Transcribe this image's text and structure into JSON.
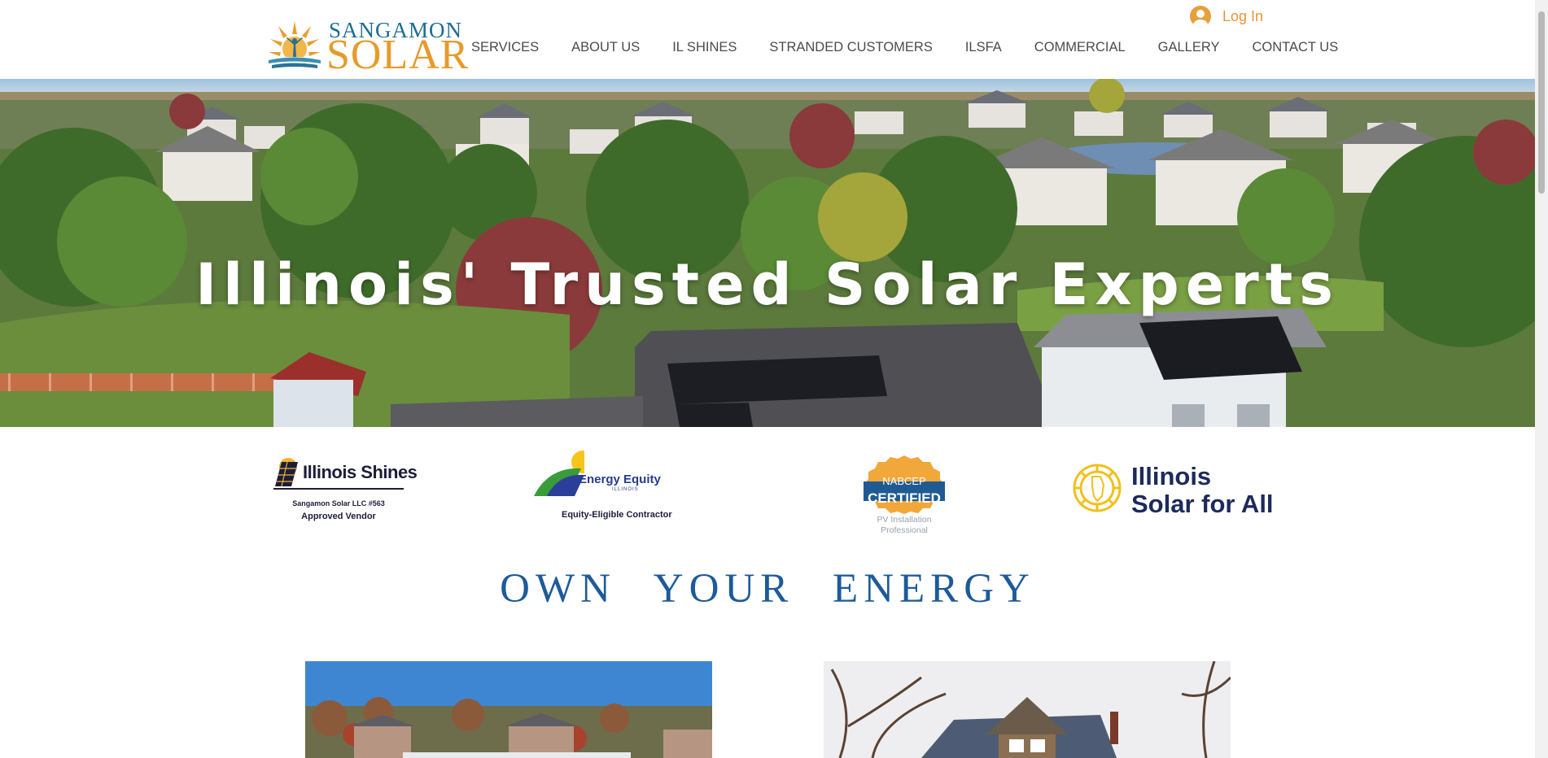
{
  "brand": {
    "name_top": "SANGAMON",
    "name_main": "SOLAR",
    "colors": {
      "orange": "#e59b2c",
      "teal": "#1c6d92",
      "heading_blue": "#1d5a99"
    }
  },
  "login": {
    "label": "Log In",
    "icon": "user-avatar-icon"
  },
  "nav": {
    "items": [
      {
        "label": "SERVICES"
      },
      {
        "label": "ABOUT US"
      },
      {
        "label": "IL SHINES"
      },
      {
        "label": "STRANDED CUSTOMERS"
      },
      {
        "label": "ILSFA"
      },
      {
        "label": "COMMERCIAL"
      },
      {
        "label": "GALLERY"
      },
      {
        "label": "CONTACT US"
      }
    ]
  },
  "hero": {
    "title": "Illinois' Trusted Solar Experts"
  },
  "badges": {
    "illinois_shines": {
      "title": "Illinois Shines",
      "line1": "Sangamon Solar LLC #563",
      "line2": "Approved Vendor"
    },
    "energy_equity": {
      "title": "Energy Equity",
      "small": "ILLINOIS",
      "sub": "Equity-Eligible Contractor"
    },
    "nabcep": {
      "top": "NABCEP",
      "main": "CERTIFIED",
      "sub1": "PV Installation",
      "sub2": "Professional"
    },
    "solar_for_all": {
      "line1": "Illinois",
      "line2": "Solar for All"
    }
  },
  "section": {
    "heading": "OWN YOUR ENERGY"
  }
}
